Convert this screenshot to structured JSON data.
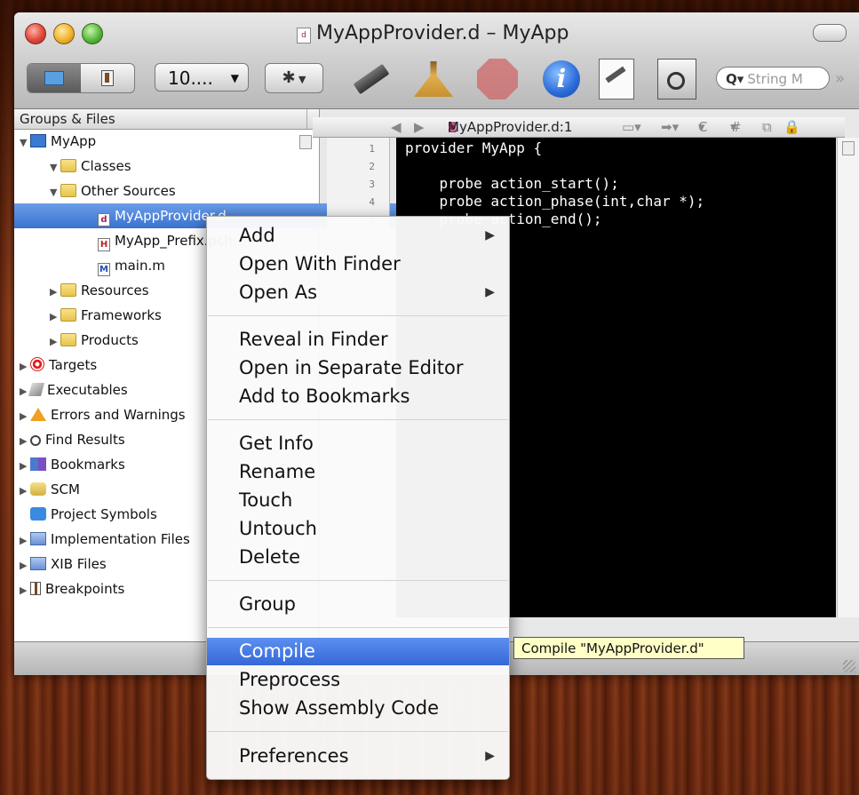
{
  "window": {
    "title": "MyAppProvider.d – MyApp"
  },
  "toolbar": {
    "overview_value": "10....",
    "action_icon": "gear-icon",
    "search_placeholder": "String M",
    "icons": [
      "build-and-go-icon",
      "clean-icon",
      "stop-icon",
      "info-icon",
      "build-icon",
      "snapshot-icon"
    ]
  },
  "sidebar": {
    "header": "Groups & Files",
    "items": [
      {
        "label": "MyApp",
        "icon": "project-icon",
        "expanded": true
      },
      {
        "label": "Classes",
        "icon": "folder-icon",
        "expanded": true
      },
      {
        "label": "Other Sources",
        "icon": "folder-icon",
        "expanded": true
      },
      {
        "label": "MyAppProvider.d",
        "icon": "d-file-icon",
        "selected": true
      },
      {
        "label": "MyApp_Prefix.pch",
        "icon": "h-file-icon"
      },
      {
        "label": "main.m",
        "icon": "m-file-icon"
      },
      {
        "label": "Resources",
        "icon": "folder-icon"
      },
      {
        "label": "Frameworks",
        "icon": "folder-icon"
      },
      {
        "label": "Products",
        "icon": "folder-icon"
      },
      {
        "label": "Targets",
        "icon": "target-icon"
      },
      {
        "label": "Executables",
        "icon": "executable-icon"
      },
      {
        "label": "Errors and Warnings",
        "icon": "warning-icon"
      },
      {
        "label": "Find Results",
        "icon": "magnifier-icon"
      },
      {
        "label": "Bookmarks",
        "icon": "bookmarks-icon"
      },
      {
        "label": "SCM",
        "icon": "scm-icon"
      },
      {
        "label": "Project Symbols",
        "icon": "symbols-icon"
      },
      {
        "label": "Implementation Files",
        "icon": "implementation-icon"
      },
      {
        "label": "XIB Files",
        "icon": "xib-icon"
      },
      {
        "label": "Breakpoints",
        "icon": "breakpoint-icon"
      }
    ]
  },
  "editor": {
    "file_label": "MyAppProvider.d:1",
    "nav_popups": [
      "C",
      "#"
    ],
    "line_numbers": [
      "1",
      "2",
      "3",
      "4",
      "5"
    ],
    "lines": [
      "provider MyApp {",
      "",
      "    probe action_start();",
      "    probe action_phase(int,char *);",
      "    probe action_end();"
    ]
  },
  "context_menu": {
    "items": [
      {
        "label": "Add",
        "submenu": true
      },
      {
        "label": "Open With Finder"
      },
      {
        "label": "Open As",
        "submenu": true
      },
      {
        "label": "Reveal in Finder"
      },
      {
        "label": "Open in Separate Editor"
      },
      {
        "label": "Add to Bookmarks"
      },
      {
        "label": "Get Info"
      },
      {
        "label": "Rename"
      },
      {
        "label": "Touch"
      },
      {
        "label": "Untouch"
      },
      {
        "label": "Delete"
      },
      {
        "label": "Group"
      },
      {
        "label": "Compile",
        "highlighted": true
      },
      {
        "label": "Preprocess"
      },
      {
        "label": "Show Assembly Code"
      },
      {
        "label": "Preferences",
        "submenu": true
      }
    ],
    "submenu_arrow": "▶"
  },
  "tooltip": {
    "text": "Compile \"MyAppProvider.d\""
  }
}
